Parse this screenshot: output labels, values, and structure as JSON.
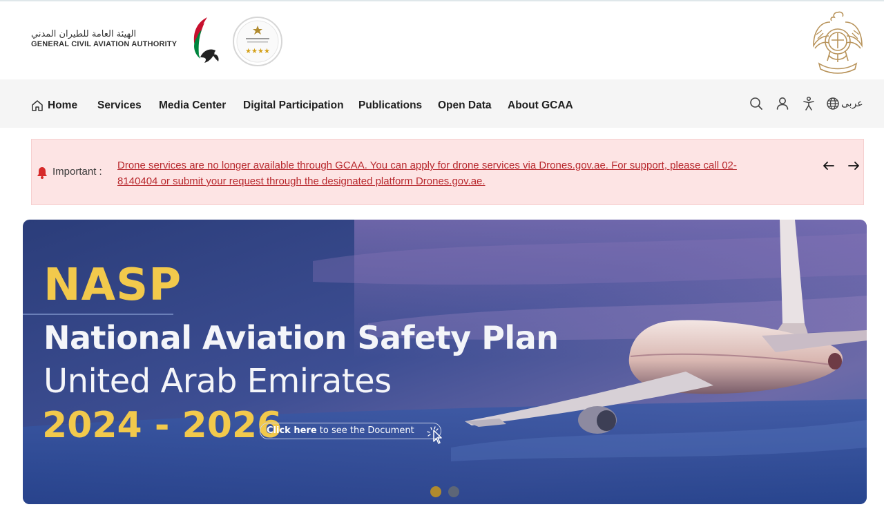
{
  "header": {
    "logo_arabic": "الهيئة العامة للطيران المدني",
    "logo_english": "GENERAL CIVIL AVIATION AUTHORITY"
  },
  "nav": {
    "items": [
      "Home",
      "Services",
      "Media Center",
      "Digital Participation",
      "Publications",
      "Open Data",
      "About GCAA"
    ],
    "language_toggle": "عربى",
    "icons": [
      "search-icon",
      "user-icon",
      "accessibility-icon",
      "globe-icon"
    ]
  },
  "alert": {
    "label": "Important :",
    "message": "Drone services are no longer available through GCAA. You can apply for drone services via Drones.gov.ae. For support, please call 02-8140404 or submit your request through the designated platform Drones.gov.ae.",
    "icons": [
      "bell-icon",
      "arrow-left-icon",
      "arrow-right-icon"
    ]
  },
  "banner": {
    "acronym": "NASP",
    "title": "National Aviation Safety Plan",
    "subtitle": "United Arab Emirates",
    "years": "2024 - 2026",
    "cta_bold": "Click here",
    "cta_rest": " to see the Document",
    "slide_count": 2,
    "active_slide": 1
  },
  "colors": {
    "nav_bg": "#f5f5f5",
    "alert_bg": "#fde4e4",
    "alert_link": "#b8282d",
    "banner_accent": "#f2c94c",
    "dot_active": "#b08a2e",
    "dot_idle": "#5d6677"
  }
}
